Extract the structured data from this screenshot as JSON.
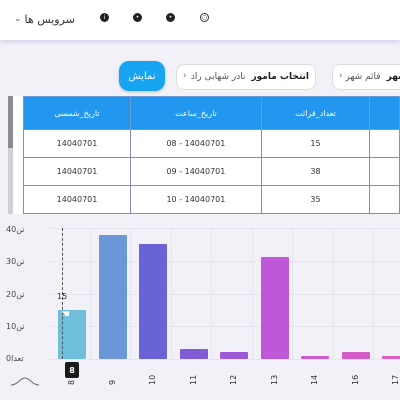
{
  "topbar": {
    "services_label": "سرویس ها",
    "icons": [
      "info-icon",
      "settings-icon",
      "user-icon",
      "globe-icon"
    ]
  },
  "filters": {
    "show_button": "نمایش",
    "officer": {
      "label": "انتخاب مامور",
      "value": "نادر شهابی راد"
    },
    "city": {
      "label": "شهر",
      "value": "قائم شهر"
    }
  },
  "table": {
    "columns": [
      "تاریخ_شمسی",
      "تاریخ_ساعت",
      "تعداد_قرائت"
    ],
    "rows": [
      [
        "14040701",
        "08 - 14040701",
        "15"
      ],
      [
        "14040701",
        "09 - 14040701",
        "38"
      ],
      [
        "14040701",
        "10 - 14040701",
        "35"
      ]
    ]
  },
  "chart": {
    "y_ticks": [
      "40تن",
      "30تن",
      "20تن",
      "10تن",
      "0تعدا"
    ],
    "tooltip_value": "15",
    "hover_label": "8"
  },
  "chart_data": {
    "type": "bar",
    "categories": [
      "8",
      "9",
      "10",
      "11",
      "12",
      "13",
      "14",
      "16",
      "17"
    ],
    "values": [
      15,
      38,
      35,
      3,
      2,
      31,
      1,
      2,
      1
    ],
    "ylim": [
      0,
      40
    ],
    "colors": [
      "#6fbfdc",
      "#6b96d8",
      "#6a63d6",
      "#7f5bd4",
      "#9b59d6",
      "#be58d8",
      "#cf59cf",
      "#d65ac8",
      "#dc5fc0"
    ]
  }
}
